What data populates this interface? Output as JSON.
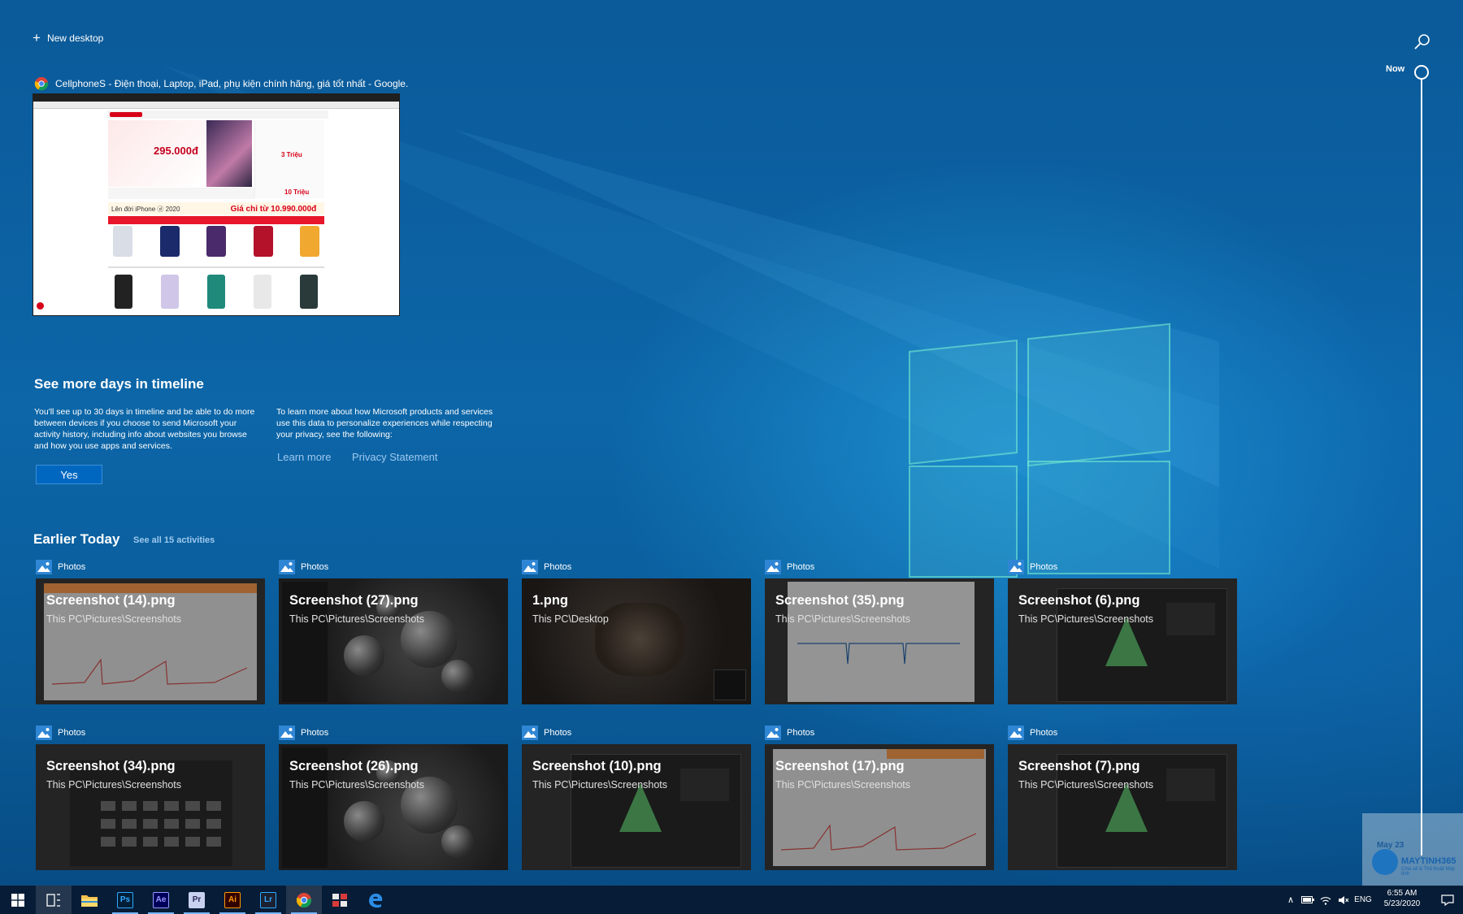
{
  "new_desktop": {
    "label": "New desktop"
  },
  "timeline": {
    "now_label": "Now"
  },
  "current_activity": {
    "app": "Google Chrome",
    "title": "CellphoneS - Điện thoại, Laptop, iPad, phụ kiện chính hãng, giá tốt nhất - Google...",
    "thumbnail": {
      "banner_price": "295.000đ",
      "promo_text": "Lên đời iPhone ⓓ 2020",
      "promo_price": "Giá chỉ từ 10.990.000đ",
      "side_tag_1": "3 Triệu",
      "side_tag_2": "10 Triệu"
    }
  },
  "see_more": {
    "title": "See more days in timeline",
    "left_text": "You'll see up to 30 days in timeline and be able to do more between devices if you choose to send Microsoft your activity history, including info about websites you browse and how you use apps and services.",
    "right_text": "To learn more about how Microsoft products and services use this data to personalize experiences while respecting your privacy, see the following:",
    "yes_label": "Yes",
    "learn_more_label": "Learn more",
    "privacy_label": "Privacy Statement"
  },
  "earlier_today": {
    "title": "Earlier Today",
    "see_all_label": "See all 15 activities",
    "cards": [
      {
        "app": "Photos",
        "title": "Screenshot (14).png",
        "path": "This PC\\Pictures\\Screenshots",
        "variant": "light"
      },
      {
        "app": "Photos",
        "title": "Screenshot (27).png",
        "path": "This PC\\Pictures\\Screenshots",
        "variant": "spheres"
      },
      {
        "app": "Photos",
        "title": "1.png",
        "path": "This PC\\Desktop",
        "variant": "game"
      },
      {
        "app": "Photos",
        "title": "Screenshot (35).png",
        "path": "This PC\\Pictures\\Screenshots",
        "variant": "doc"
      },
      {
        "app": "Photos",
        "title": "Screenshot (6).png",
        "path": "This PC\\Pictures\\Screenshots",
        "variant": "dark"
      },
      {
        "app": "Photos",
        "title": "Screenshot (34).png",
        "path": "This PC\\Pictures\\Screenshots",
        "variant": "grid"
      },
      {
        "app": "Photos",
        "title": "Screenshot (26).png",
        "path": "This PC\\Pictures\\Screenshots",
        "variant": "spheres"
      },
      {
        "app": "Photos",
        "title": "Screenshot (10).png",
        "path": "This PC\\Pictures\\Screenshots",
        "variant": "dark"
      },
      {
        "app": "Photos",
        "title": "Screenshot (17).png",
        "path": "This PC\\Pictures\\Screenshots",
        "variant": "light"
      },
      {
        "app": "Photos",
        "title": "Screenshot (7).png",
        "path": "This PC\\Pictures\\Screenshots",
        "variant": "dark"
      }
    ]
  },
  "watermark": {
    "date": "May 23",
    "name": "MAYTINH365",
    "tagline": "Chia sẻ & Thủ thuật Máy tính"
  },
  "taskbar": {
    "apps": [
      {
        "name": "start-button",
        "icon": "windows-logo-icon",
        "label": ""
      },
      {
        "name": "task-view-button",
        "icon": "task-view-icon",
        "label": ""
      },
      {
        "name": "file-explorer",
        "icon": "folder-icon",
        "label": ""
      },
      {
        "name": "photoshop",
        "icon": "photoshop-icon",
        "label": "Ps",
        "color": "#31a8ff",
        "bg": "#001e36"
      },
      {
        "name": "after-effects",
        "icon": "after-effects-icon",
        "label": "Ae",
        "color": "#9999ff",
        "bg": "#00005b"
      },
      {
        "name": "premiere",
        "icon": "premiere-icon",
        "label": "Pr",
        "color": "#2a2a5a",
        "bg": "#c8d2f0"
      },
      {
        "name": "illustrator",
        "icon": "illustrator-icon",
        "label": "Ai",
        "color": "#ff9a00",
        "bg": "#330000"
      },
      {
        "name": "lightroom",
        "icon": "lightroom-icon",
        "label": "Lr",
        "color": "#31a8ff",
        "bg": "#1b2130"
      },
      {
        "name": "chrome",
        "icon": "chrome-icon",
        "label": ""
      },
      {
        "name": "app-grid",
        "icon": "app-grid-icon",
        "label": ""
      },
      {
        "name": "edge",
        "icon": "edge-icon",
        "label": ""
      }
    ],
    "tray": {
      "language": "ENG",
      "time": "6:55 AM",
      "date": "5/23/2020"
    }
  }
}
